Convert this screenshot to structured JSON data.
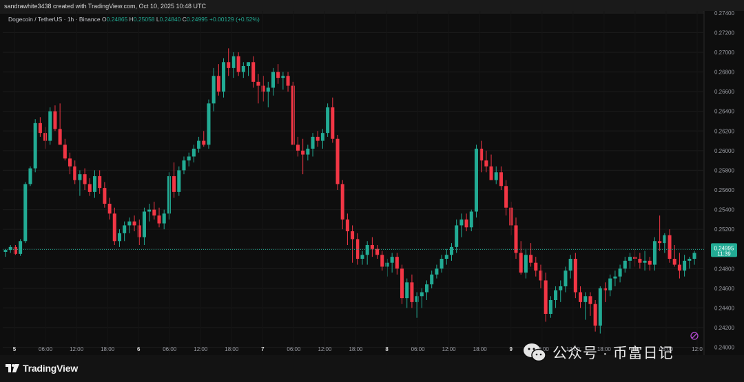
{
  "header": {
    "attribution": "sandrawhite3438 created with TradingView.com, Oct 10, 2025 10:48 UTC"
  },
  "legend": {
    "symbol": "Dogecoin / TetherUS · 1h · Binance",
    "o_label": "O",
    "o_value": "0.24865",
    "h_label": "H",
    "h_value": "0.25058",
    "l_label": "L",
    "l_value": "0.24840",
    "c_label": "C",
    "c_value": "0.24995",
    "change": "+0.00129 (+0.52%)"
  },
  "price_tag": {
    "price": "0.24995",
    "countdown": "11:39"
  },
  "colors": {
    "up": "#22ab94",
    "down": "#f23645",
    "background": "#0e0e0e",
    "grid": "#1c1c1c"
  },
  "footer": {
    "brand": "TradingView",
    "watermark": "公众号 · 币富日记"
  },
  "chart_data": {
    "type": "candlestick",
    "ylim": [
      0.2392,
      0.2742
    ],
    "y_ticks": [
      "0.27400",
      "0.27200",
      "0.27000",
      "0.26800",
      "0.26600",
      "0.26400",
      "0.26200",
      "0.26000",
      "0.25800",
      "0.25600",
      "0.25400",
      "0.25200",
      "0.25000",
      "0.24800",
      "0.24600",
      "0.24400",
      "0.24200",
      "0.24000"
    ],
    "x_ticks": [
      "5",
      "06:00",
      "12:00",
      "18:00",
      "6",
      "06:00",
      "12:00",
      "18:00",
      "7",
      "06:00",
      "12:00",
      "18:00",
      "8",
      "06:00",
      "12:00",
      "18:00",
      "9",
      "06:00",
      "12:00",
      "18:00",
      "10",
      "06:00",
      "12:0"
    ],
    "last_close": 0.24995,
    "candles": [
      [
        0.2497,
        0.25,
        0.2492,
        0.2499
      ],
      [
        0.2499,
        0.2504,
        0.2496,
        0.2502
      ],
      [
        0.2502,
        0.2504,
        0.2494,
        0.2495
      ],
      [
        0.2495,
        0.251,
        0.2493,
        0.2508
      ],
      [
        0.2508,
        0.2568,
        0.2506,
        0.2566
      ],
      [
        0.2566,
        0.2584,
        0.2564,
        0.2582
      ],
      [
        0.2582,
        0.2632,
        0.2578,
        0.2628
      ],
      [
        0.2628,
        0.2634,
        0.2614,
        0.2618
      ],
      [
        0.2618,
        0.2624,
        0.2602,
        0.261
      ],
      [
        0.261,
        0.2644,
        0.2606,
        0.264
      ],
      [
        0.264,
        0.2646,
        0.262,
        0.2622
      ],
      [
        0.2622,
        0.2648,
        0.2608,
        0.2606
      ],
      [
        0.2606,
        0.2612,
        0.259,
        0.2592
      ],
      [
        0.2592,
        0.2598,
        0.2576,
        0.2584
      ],
      [
        0.2584,
        0.259,
        0.2566,
        0.257
      ],
      [
        0.257,
        0.258,
        0.2554,
        0.2576
      ],
      [
        0.2576,
        0.2582,
        0.256,
        0.2566
      ],
      [
        0.2566,
        0.2572,
        0.2554,
        0.2558
      ],
      [
        0.2558,
        0.258,
        0.2552,
        0.2574
      ],
      [
        0.2574,
        0.258,
        0.2556,
        0.2562
      ],
      [
        0.2562,
        0.2568,
        0.2542,
        0.2546
      ],
      [
        0.2546,
        0.2552,
        0.253,
        0.2536
      ],
      [
        0.2536,
        0.2542,
        0.2504,
        0.2508
      ],
      [
        0.2508,
        0.252,
        0.2502,
        0.2516
      ],
      [
        0.2516,
        0.2528,
        0.2508,
        0.2524
      ],
      [
        0.2524,
        0.2532,
        0.2516,
        0.2528
      ],
      [
        0.2528,
        0.2534,
        0.2518,
        0.2524
      ],
      [
        0.2524,
        0.253,
        0.2504,
        0.2512
      ],
      [
        0.2512,
        0.2542,
        0.2504,
        0.2538
      ],
      [
        0.2538,
        0.2546,
        0.2528,
        0.254
      ],
      [
        0.254,
        0.2548,
        0.253,
        0.2534
      ],
      [
        0.2534,
        0.2542,
        0.2522,
        0.2526
      ],
      [
        0.2526,
        0.254,
        0.252,
        0.2536
      ],
      [
        0.2536,
        0.2578,
        0.253,
        0.2574
      ],
      [
        0.2574,
        0.2588,
        0.2552,
        0.2558
      ],
      [
        0.2558,
        0.2584,
        0.2554,
        0.258
      ],
      [
        0.258,
        0.2594,
        0.2576,
        0.259
      ],
      [
        0.259,
        0.2598,
        0.2584,
        0.2594
      ],
      [
        0.2594,
        0.2606,
        0.2588,
        0.2602
      ],
      [
        0.2602,
        0.2614,
        0.2598,
        0.261
      ],
      [
        0.261,
        0.262,
        0.2604,
        0.2606
      ],
      [
        0.2606,
        0.2652,
        0.2602,
        0.2648
      ],
      [
        0.2648,
        0.2684,
        0.264,
        0.2676
      ],
      [
        0.2676,
        0.2688,
        0.2656,
        0.266
      ],
      [
        0.266,
        0.2694,
        0.2654,
        0.269
      ],
      [
        0.269,
        0.2704,
        0.2676,
        0.2684
      ],
      [
        0.2684,
        0.27,
        0.2674,
        0.2696
      ],
      [
        0.2696,
        0.27,
        0.2676,
        0.268
      ],
      [
        0.268,
        0.269,
        0.2674,
        0.2686
      ],
      [
        0.2686,
        0.269,
        0.2676,
        0.269
      ],
      [
        0.269,
        0.2696,
        0.2664,
        0.267
      ],
      [
        0.267,
        0.2678,
        0.2648,
        0.2666
      ],
      [
        0.2666,
        0.2676,
        0.265,
        0.266
      ],
      [
        0.266,
        0.267,
        0.2644,
        0.2664
      ],
      [
        0.2664,
        0.2684,
        0.2656,
        0.268
      ],
      [
        0.268,
        0.2688,
        0.2668,
        0.2674
      ],
      [
        0.2674,
        0.268,
        0.2662,
        0.2676
      ],
      [
        0.2676,
        0.268,
        0.266,
        0.2666
      ],
      [
        0.2666,
        0.267,
        0.262,
        0.2606
      ],
      [
        0.2606,
        0.2614,
        0.2594,
        0.26
      ],
      [
        0.26,
        0.2612,
        0.2576,
        0.2596
      ],
      [
        0.2596,
        0.2606,
        0.259,
        0.2602
      ],
      [
        0.2602,
        0.2618,
        0.2594,
        0.2614
      ],
      [
        0.2614,
        0.262,
        0.2604,
        0.261
      ],
      [
        0.261,
        0.2622,
        0.2602,
        0.2618
      ],
      [
        0.2618,
        0.2648,
        0.2614,
        0.2644
      ],
      [
        0.2644,
        0.2654,
        0.2608,
        0.2612
      ],
      [
        0.2612,
        0.2616,
        0.256,
        0.2566
      ],
      [
        0.2566,
        0.257,
        0.252,
        0.253
      ],
      [
        0.253,
        0.2536,
        0.2504,
        0.2518
      ],
      [
        0.2518,
        0.2524,
        0.2486,
        0.251
      ],
      [
        0.251,
        0.2516,
        0.2484,
        0.249
      ],
      [
        0.249,
        0.2498,
        0.2484,
        0.2494
      ],
      [
        0.2494,
        0.2508,
        0.2484,
        0.2504
      ],
      [
        0.2504,
        0.2512,
        0.2492,
        0.25
      ],
      [
        0.25,
        0.2504,
        0.249,
        0.2494
      ],
      [
        0.2494,
        0.2498,
        0.2478,
        0.2482
      ],
      [
        0.2482,
        0.249,
        0.2472,
        0.2486
      ],
      [
        0.2486,
        0.2496,
        0.2476,
        0.2492
      ],
      [
        0.2492,
        0.2496,
        0.2474,
        0.248
      ],
      [
        0.248,
        0.2484,
        0.2444,
        0.245
      ],
      [
        0.245,
        0.247,
        0.244,
        0.2466
      ],
      [
        0.2466,
        0.2474,
        0.244,
        0.2446
      ],
      [
        0.2446,
        0.2456,
        0.243,
        0.2452
      ],
      [
        0.2452,
        0.246,
        0.244,
        0.2456
      ],
      [
        0.2456,
        0.2468,
        0.2448,
        0.2464
      ],
      [
        0.2464,
        0.2478,
        0.246,
        0.2474
      ],
      [
        0.2474,
        0.2484,
        0.247,
        0.248
      ],
      [
        0.248,
        0.2494,
        0.2476,
        0.249
      ],
      [
        0.249,
        0.25,
        0.2484,
        0.2494
      ],
      [
        0.2494,
        0.2506,
        0.2488,
        0.2502
      ],
      [
        0.2502,
        0.253,
        0.2496,
        0.2524
      ],
      [
        0.2524,
        0.2536,
        0.2512,
        0.253
      ],
      [
        0.253,
        0.2536,
        0.2518,
        0.2522
      ],
      [
        0.2522,
        0.254,
        0.2518,
        0.2538
      ],
      [
        0.2538,
        0.2606,
        0.2532,
        0.2602
      ],
      [
        0.2602,
        0.261,
        0.2578,
        0.259
      ],
      [
        0.259,
        0.26,
        0.2578,
        0.2584
      ],
      [
        0.2584,
        0.2596,
        0.2572,
        0.257
      ],
      [
        0.257,
        0.2584,
        0.2566,
        0.2578
      ],
      [
        0.2578,
        0.2584,
        0.256,
        0.2564
      ],
      [
        0.2564,
        0.257,
        0.2534,
        0.2542
      ],
      [
        0.2542,
        0.2548,
        0.2514,
        0.2524
      ],
      [
        0.2524,
        0.2532,
        0.249,
        0.2496
      ],
      [
        0.2496,
        0.2508,
        0.2474,
        0.2476
      ],
      [
        0.2476,
        0.25,
        0.247,
        0.2494
      ],
      [
        0.2494,
        0.2506,
        0.2482,
        0.2486
      ],
      [
        0.2486,
        0.2492,
        0.2472,
        0.2478
      ],
      [
        0.2478,
        0.2484,
        0.246,
        0.2468
      ],
      [
        0.2468,
        0.2476,
        0.2426,
        0.2434
      ],
      [
        0.2434,
        0.2452,
        0.243,
        0.2448
      ],
      [
        0.2448,
        0.2462,
        0.244,
        0.2458
      ],
      [
        0.2458,
        0.2468,
        0.2446,
        0.2462
      ],
      [
        0.2462,
        0.2482,
        0.2456,
        0.2478
      ],
      [
        0.2478,
        0.2494,
        0.247,
        0.249
      ],
      [
        0.249,
        0.2496,
        0.245,
        0.2456
      ],
      [
        0.2456,
        0.2462,
        0.244,
        0.2446
      ],
      [
        0.2446,
        0.2456,
        0.2428,
        0.2452
      ],
      [
        0.2452,
        0.2456,
        0.2432,
        0.2444
      ],
      [
        0.2444,
        0.2448,
        0.2416,
        0.2422
      ],
      [
        0.2422,
        0.2462,
        0.2414,
        0.246
      ],
      [
        0.246,
        0.2466,
        0.2446,
        0.2458
      ],
      [
        0.2458,
        0.2474,
        0.2452,
        0.247
      ],
      [
        0.247,
        0.2478,
        0.2462,
        0.2472
      ],
      [
        0.2472,
        0.2484,
        0.2466,
        0.248
      ],
      [
        0.248,
        0.2492,
        0.2476,
        0.2488
      ],
      [
        0.2488,
        0.2496,
        0.248,
        0.2492
      ],
      [
        0.2492,
        0.25,
        0.2482,
        0.249
      ],
      [
        0.249,
        0.2496,
        0.248,
        0.2486
      ],
      [
        0.2486,
        0.2498,
        0.2478,
        0.2488
      ],
      [
        0.2488,
        0.2492,
        0.2478,
        0.2484
      ],
      [
        0.2484,
        0.2512,
        0.2478,
        0.2508
      ],
      [
        0.2508,
        0.2534,
        0.2498,
        0.2506
      ],
      [
        0.2506,
        0.2516,
        0.2496,
        0.2514
      ],
      [
        0.2514,
        0.252,
        0.2486,
        0.249
      ],
      [
        0.249,
        0.2504,
        0.2482,
        0.2484
      ],
      [
        0.2484,
        0.2496,
        0.247,
        0.2478
      ],
      [
        0.2478,
        0.2494,
        0.2472,
        0.2488
      ],
      [
        0.2488,
        0.2492,
        0.248,
        0.249
      ],
      [
        0.249,
        0.2498,
        0.2484,
        0.2496
      ]
    ]
  }
}
